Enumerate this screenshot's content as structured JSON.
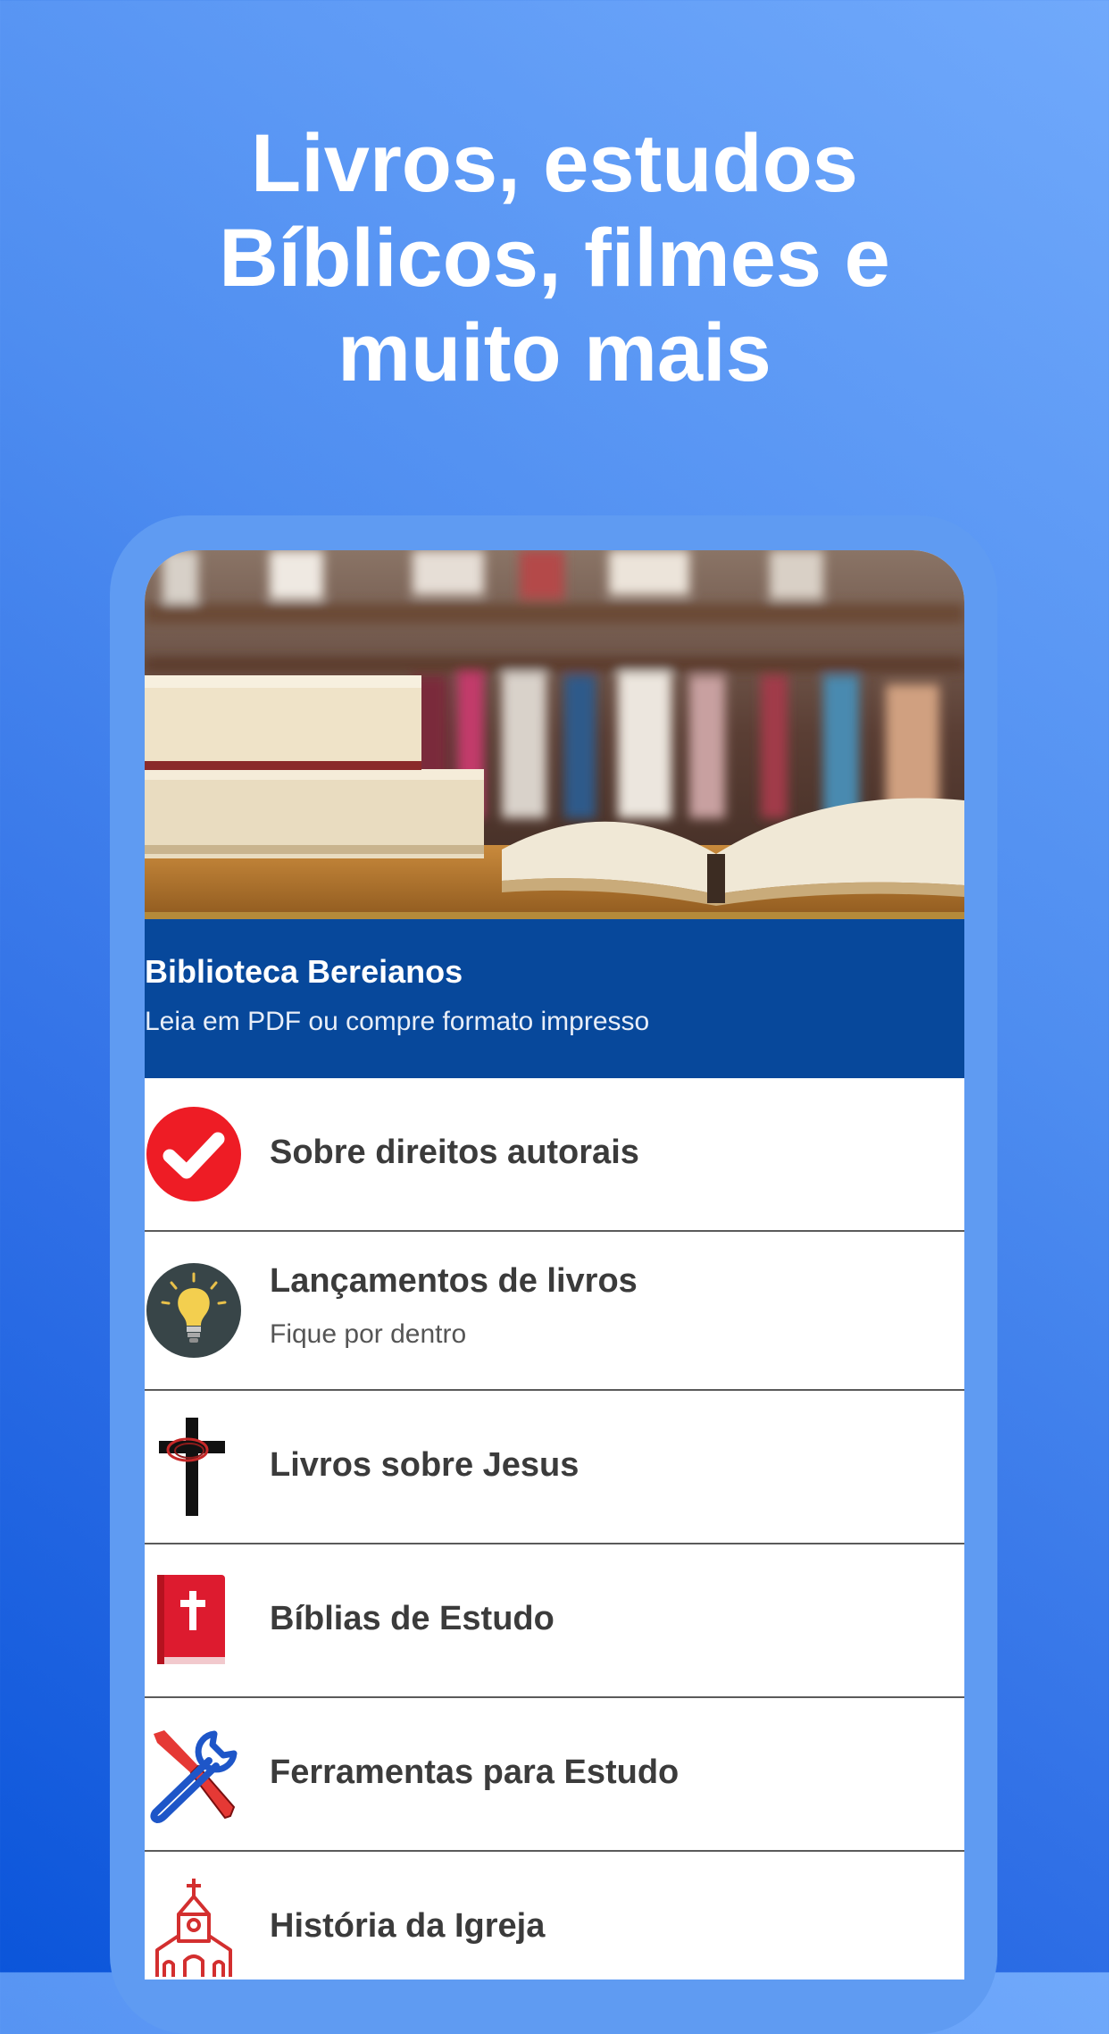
{
  "headline": [
    "Livros, estudos",
    "Bíblicos, filmes e",
    "muito mais"
  ],
  "app_header": {
    "title": "Biblioteca Bereianos",
    "subtitle": "Leia em PDF ou compre formato impresso"
  },
  "menu": [
    {
      "label": "Sobre direitos autorais",
      "icon": "checkmark-icon"
    },
    {
      "label": "Lançamentos de livros",
      "sublabel": "Fique por dentro",
      "icon": "lightbulb-icon"
    },
    {
      "label": "Livros sobre Jesus",
      "icon": "cross-icon"
    },
    {
      "label": "Bíblias de Estudo",
      "icon": "bible-icon"
    },
    {
      "label": "Ferramentas para Estudo",
      "icon": "tools-icon"
    },
    {
      "label": "História da Igreja",
      "icon": "church-icon"
    }
  ],
  "colors": {
    "header_bg": "#07489b",
    "frame": "#5f9bf2",
    "check_red": "#ee1c25",
    "bible_red": "#dd1b2f"
  }
}
